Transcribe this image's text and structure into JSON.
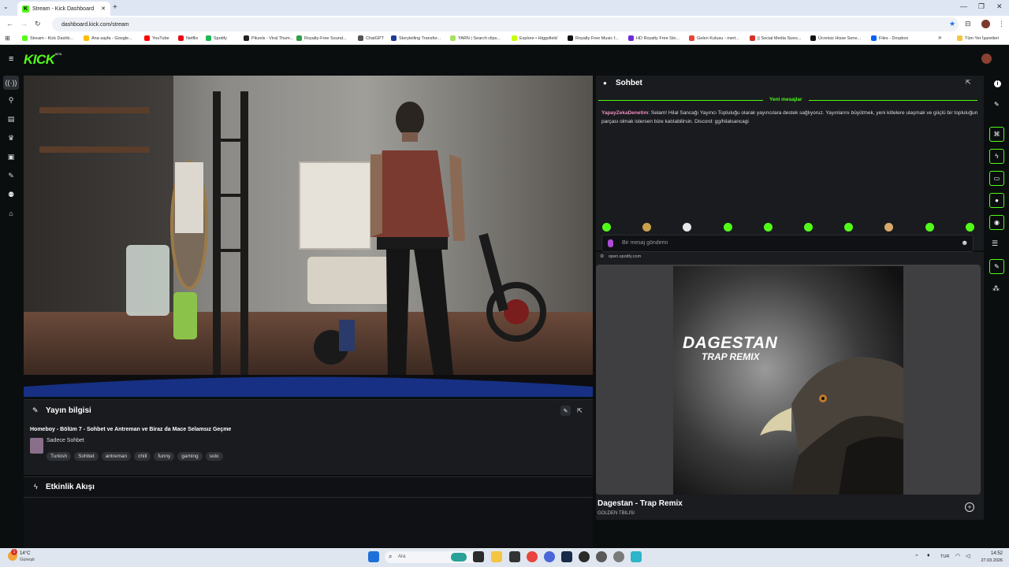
{
  "browser": {
    "tab_title": "Stream - Kick Dashboard",
    "new_tab": "+",
    "url": "dashboard.kick.com/stream",
    "bookmarks": [
      {
        "label": "Stream - Kick Dashb...",
        "color": "#53fc18"
      },
      {
        "label": "Ana sayfa - Google...",
        "color": "#fbbc04"
      },
      {
        "label": "YouTube",
        "color": "#ff0000"
      },
      {
        "label": "Netflix",
        "color": "#e50914"
      },
      {
        "label": "Spotify",
        "color": "#1db954"
      },
      {
        "label": "Pikzels - Viral Thum...",
        "color": "#222222"
      },
      {
        "label": "Royalty-Free Sound...",
        "color": "#2f9e44"
      },
      {
        "label": "ChatGPT",
        "color": "#555555"
      },
      {
        "label": "Storytelling Transfor...",
        "color": "#1f3a93"
      },
      {
        "label": "YARN | Search clips...",
        "color": "#a8e063"
      },
      {
        "label": "Explore • Higgsfield",
        "color": "#c6ff00"
      },
      {
        "label": "Royalty Free Music f...",
        "color": "#111111"
      },
      {
        "label": "HD Royalty Free Sto...",
        "color": "#6c2bd9"
      },
      {
        "label": "Gelen Kutusu - mert...",
        "color": "#ea4335"
      },
      {
        "label": "|| Social Media Sizes...",
        "color": "#d93025"
      },
      {
        "label": "Ücretsiz Hisse Sene...",
        "color": "#111111"
      },
      {
        "label": "Files - Dropbox",
        "color": "#0061fe"
      }
    ],
    "more": "»",
    "all_bookmarks": "Tüm Yer İşaretleri"
  },
  "kick": {
    "logo": "KICK",
    "logo_sup": "BETA",
    "accent": "#53fc18"
  },
  "stream_info": {
    "title": "Yayın bilgisi",
    "stream_title": "Homeboy - Bölüm 7 - Sohbet ve Antreman ve Biraz da Mace Selamsız Geçme",
    "category": "Sadece Sohbet",
    "tags": [
      "Turkish",
      "Sohbet",
      "antreman",
      "chill",
      "funny",
      "gaming",
      "solo"
    ]
  },
  "activity": {
    "title": "Etkinlik Akışı"
  },
  "chat": {
    "title": "Sohbet",
    "new_messages": "Yeni mesajlar",
    "message_user": "YapayZekaDenetim",
    "message_text": ": Selam! Hilal Sancağı Yayıncı Topluluğu olarak yayıncılara destek sağlıyoruz. Yayınlarını büyütmek, yeni kitlelere ulaşmak ve güçlü bir topluluğun parçası olmak istersen bize katılabilirsin. Discord: gg/hilalsancagi",
    "input_placeholder": "Bir mesaj gönderin"
  },
  "spotify": {
    "domain": "open.spotify.com",
    "cover_line1": "DAGESTAN",
    "cover_line2": "TRAP REMIX",
    "track": "Dagestan - Trap Remix",
    "artist": "GOLDEN TBILISI"
  },
  "taskbar": {
    "temp": "14°C",
    "weather": "Güneşli",
    "search": "Ara",
    "lang": "TUR",
    "time": "14:52",
    "date": "27.03.2026",
    "notif_count": "1"
  }
}
